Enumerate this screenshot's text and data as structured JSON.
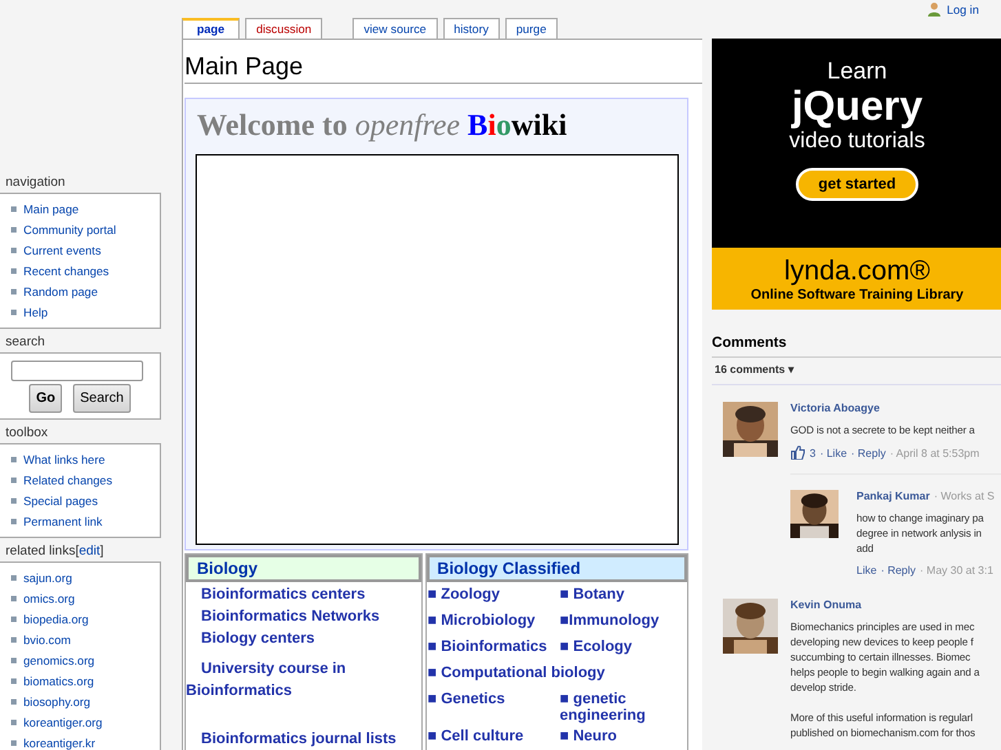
{
  "personal": {
    "login": "Log in"
  },
  "tabs": [
    {
      "label": "page",
      "selected": true,
      "missing": false
    },
    {
      "label": "discussion",
      "selected": false,
      "missing": true
    }
  ],
  "actions": [
    "view source",
    "history",
    "purge"
  ],
  "sidebar": [
    {
      "kind": "links",
      "title": "navigation",
      "items": [
        "Main page",
        "Community portal",
        "Current events",
        "Recent changes",
        "Random page",
        "Help"
      ]
    },
    {
      "kind": "search",
      "title": "search",
      "buttons": [
        "Go",
        "Search"
      ]
    },
    {
      "kind": "links",
      "title": "toolbox",
      "items": [
        "What links here",
        "Related changes",
        "Special pages",
        "Permanent link"
      ]
    },
    {
      "kind": "links",
      "title": "related links",
      "bracket_open": "[",
      "edit": "edit",
      "bracket_close": "]",
      "items": [
        "sajun.org",
        "omics.org",
        "biopedia.org",
        "bvio.com",
        "genomics.org",
        "biomatics.org",
        "biosophy.org",
        "koreantiger.org",
        "koreantiger.kr"
      ]
    }
  ],
  "page_title": "Main Page",
  "welcome": [
    {
      "text": "Welcome to ",
      "color": "#808080",
      "italic": false
    },
    {
      "text": "openfree ",
      "color": "#808080",
      "italic": true
    },
    {
      "text": "B",
      "color": "#0000ff",
      "italic": false
    },
    {
      "text": "i",
      "color": "#ff0000",
      "italic": false
    },
    {
      "text": "o",
      "color": "#339966",
      "italic": false
    },
    {
      "text": "wiki",
      "color": "#000000",
      "italic": false
    }
  ],
  "biology": {
    "title": "Biology",
    "links": [
      "Bioinformatics centers",
      "Bioinformatics Networks",
      "Biology centers",
      "University course in Bioinformatics",
      "Bioinformatics journal lists"
    ]
  },
  "classified": {
    "title": "Biology Classified",
    "rows": [
      [
        "■ Zoology",
        "■ Botany"
      ],
      [
        "■ Microbiology",
        "■Immunology"
      ],
      [
        "■ Bioinformatics",
        "■ Ecology"
      ],
      [
        "■ Computational biology"
      ],
      [
        "■ Genetics",
        "■ genetic engineering"
      ],
      [
        "■ Cell culture",
        "■ Neuro"
      ]
    ]
  },
  "ad": {
    "lines": [
      "Learn",
      "jQuery",
      "video tutorials"
    ],
    "button": "get started",
    "brand": "lynda.com®",
    "tagline": "Online Software Training Library"
  },
  "comments": {
    "title": "Comments",
    "count": "16 comments ▾",
    "items": [
      {
        "name": "Victoria Aboagye",
        "text": "GOD is not a secrete to be kept neither a",
        "likes": "3",
        "like": "· Like",
        "reply": "· Reply",
        "time": "· April 8 at 5:53pm",
        "replies": [
          {
            "name": "Pankaj Kumar",
            "work": "· Works at S",
            "text": "how to change imaginary pa\ndegree in network anlysis in\nadd",
            "like": "Like",
            "reply": "· Reply",
            "time": "· May 30 at 3:1"
          }
        ]
      },
      {
        "name": "Kevin Onuma",
        "text": "Biomechanics principles are used in mec\ndeveloping new devices to keep people f\nsuccumbing to certain illnesses. Biomec\nhelps people to begin walking again and a\ndevelop stride.\n\nMore of this useful information is regularl\npublished on biomechanism.com for thos"
      }
    ]
  }
}
